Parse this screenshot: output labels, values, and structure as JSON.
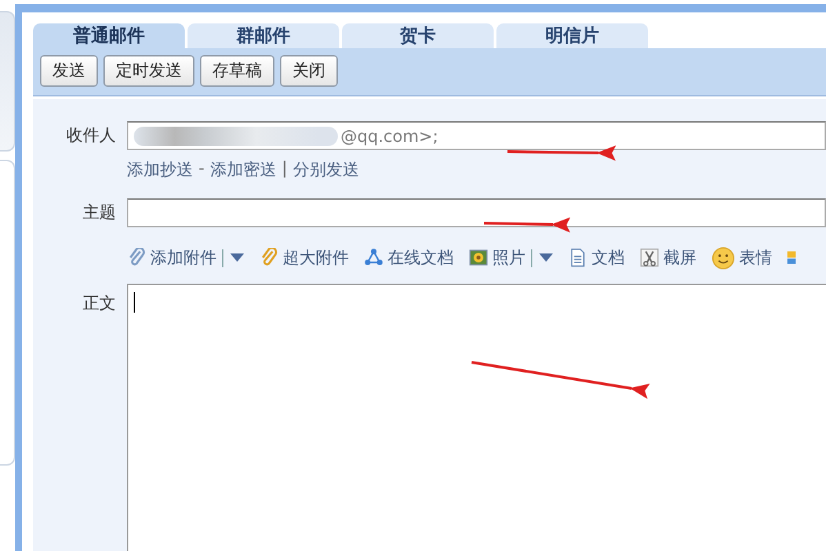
{
  "tabs": [
    {
      "label": "普通邮件",
      "selected": true
    },
    {
      "label": "群邮件",
      "selected": false
    },
    {
      "label": "贺卡",
      "selected": false
    },
    {
      "label": "明信片",
      "selected": false
    }
  ],
  "toolbar_buttons": [
    "发送",
    "定时发送",
    "存草稿",
    "关闭"
  ],
  "recipient": {
    "label": "收件人",
    "value": "@qq.com>;",
    "redacted": true
  },
  "recipient_links": [
    {
      "label": "添加抄送",
      "separator_after": "-"
    },
    {
      "label": "添加密送",
      "separator_after": "|"
    },
    {
      "label": "分别发送"
    }
  ],
  "subject": {
    "label": "主题"
  },
  "attach_tools": [
    {
      "kind": "attach",
      "label": "添加附件",
      "has_menu": true
    },
    {
      "kind": "big-attach",
      "label": "超大附件",
      "has_menu": false
    },
    {
      "kind": "online-doc",
      "label": "在线文档",
      "has_menu": false
    },
    {
      "kind": "photo",
      "label": "照片",
      "has_menu": true
    },
    {
      "kind": "doc",
      "label": "文档",
      "has_menu": false
    },
    {
      "kind": "screenshot",
      "label": "截屏",
      "has_menu": false
    },
    {
      "kind": "emoji",
      "label": "表情",
      "has_menu": false
    },
    {
      "kind": "more"
    }
  ],
  "body": {
    "label": "正文"
  }
}
